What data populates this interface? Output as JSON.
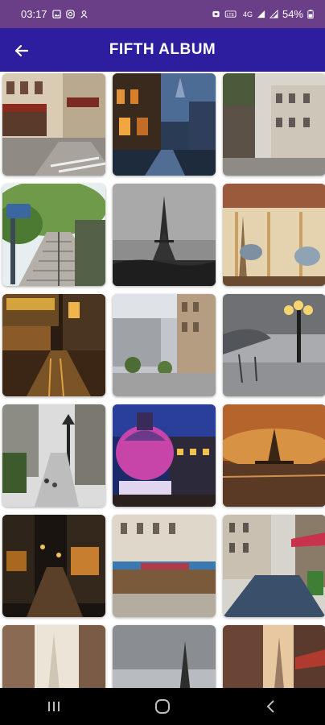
{
  "status_bar": {
    "time": "03:17",
    "battery": "54%",
    "network": "4G"
  },
  "app_bar": {
    "title": "FIFTH ALBUM",
    "back_icon": "arrow-left-icon"
  },
  "colors": {
    "status_bar": "#6a3f87",
    "app_bar": "#2d1ea0",
    "nav_bar": "#000000"
  },
  "photos": [
    {
      "subject": "paris-cafe-street"
    },
    {
      "subject": "night-street-painting"
    },
    {
      "subject": "rainy-paris-street"
    },
    {
      "subject": "montmartre-stairs"
    },
    {
      "subject": "eiffel-tower-black-white"
    },
    {
      "subject": "carousel-eiffel"
    },
    {
      "subject": "night-cafe-rain"
    },
    {
      "subject": "boulevard-buildings"
    },
    {
      "subject": "street-lamp-rain"
    },
    {
      "subject": "snowy-lamp-street"
    },
    {
      "subject": "pink-domed-building-night"
    },
    {
      "subject": "sunset-eiffel-reflection"
    },
    {
      "subject": "night-cafe-alley"
    },
    {
      "subject": "cafe-terrace-street"
    },
    {
      "subject": "cobblestone-street-flowers"
    },
    {
      "subject": "eiffel-street-view"
    },
    {
      "subject": "eiffel-skyline"
    },
    {
      "subject": "eiffel-street-sunset"
    }
  ],
  "nav_bar": {
    "recents_icon": "recents-icon",
    "home_icon": "home-icon",
    "back_icon": "back-chevron-icon"
  }
}
